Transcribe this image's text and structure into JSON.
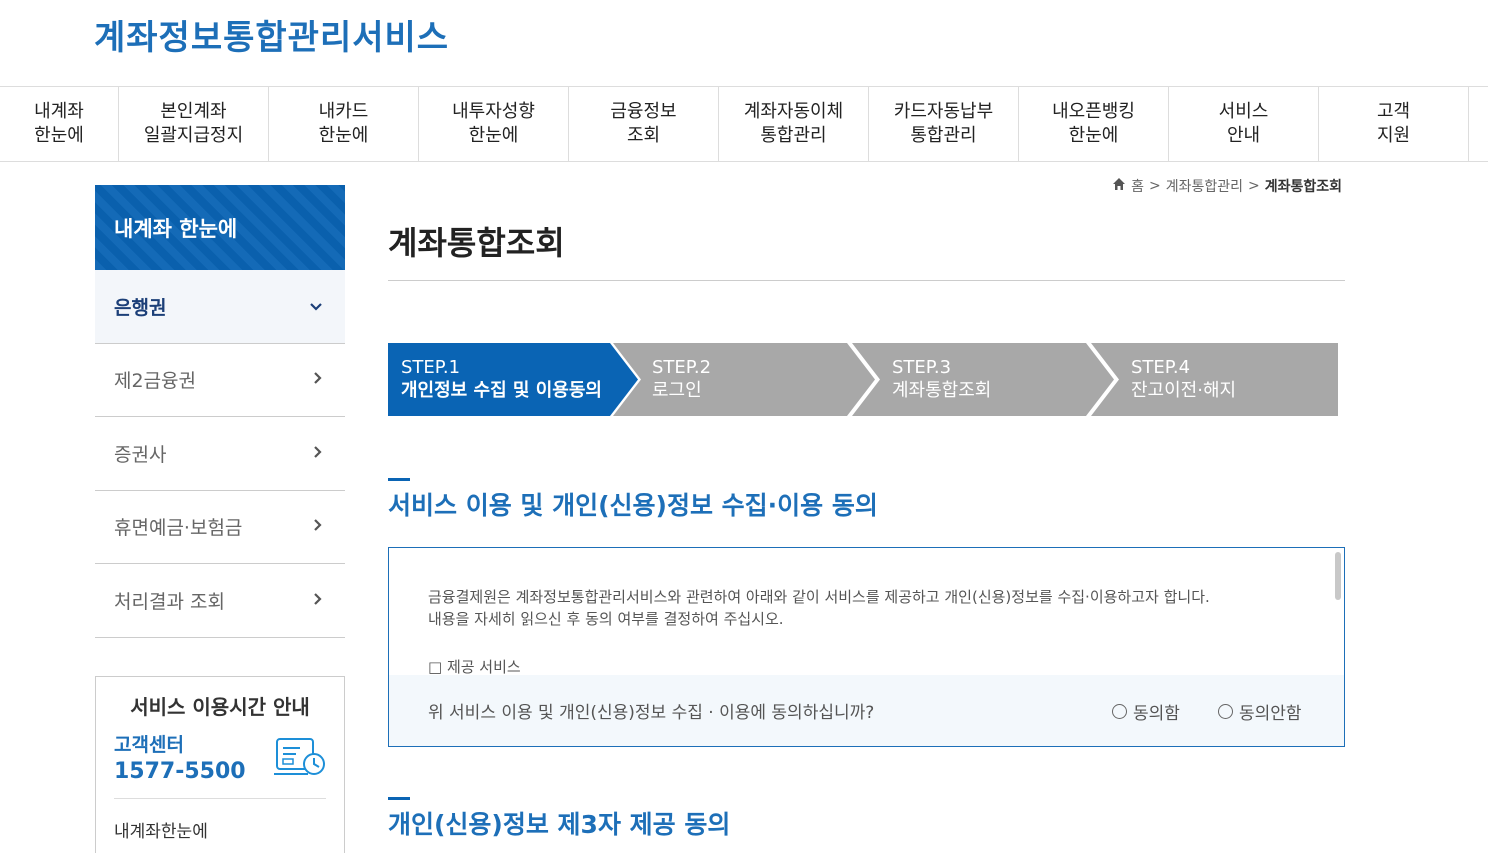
{
  "header": {
    "logo_text": "계좌정보통합관리서비스"
  },
  "gnb": [
    {
      "label": "내계좌\n한눈에"
    },
    {
      "label": "본인계좌\n일괄지급정지"
    },
    {
      "label": "내카드\n한눈에"
    },
    {
      "label": "내투자성향\n한눈에"
    },
    {
      "label": "금융정보\n조회"
    },
    {
      "label": "계좌자동이체\n통합관리"
    },
    {
      "label": "카드자동납부\n통합관리"
    },
    {
      "label": "내오픈뱅킹\n한눈에"
    },
    {
      "label": "서비스\n안내"
    },
    {
      "label": "고객\n지원"
    }
  ],
  "sidebar": {
    "title": "내계좌 한눈에",
    "items": [
      {
        "label": "은행권",
        "icon": "chevron-down-icon",
        "active": true
      },
      {
        "label": "제2금융권",
        "icon": "chevron-right-icon"
      },
      {
        "label": "증권사",
        "icon": "chevron-right-icon"
      },
      {
        "label": "휴면예금·보험금",
        "icon": "chevron-right-icon"
      },
      {
        "label": "처리결과 조회",
        "icon": "chevron-right-icon"
      }
    ],
    "service_box": {
      "title": "서비스 이용시간 안내",
      "cs_label": "고객센터",
      "cs_phone": "1577-5500",
      "link": "내계좌한눈에"
    }
  },
  "breadcrumb": {
    "home": "홈",
    "level1": "계좌통합관리",
    "current": "계좌통합조회",
    "separator": ">"
  },
  "page": {
    "title": "계좌통합조회"
  },
  "steps": [
    {
      "num": "STEP.1",
      "label": "개인정보 수집 및 이용동의",
      "active": true
    },
    {
      "num": "STEP.2",
      "label": "로그인"
    },
    {
      "num": "STEP.3",
      "label": "계좌통합조회"
    },
    {
      "num": "STEP.4",
      "label": "잔고이전·해지"
    }
  ],
  "section1": {
    "title": "서비스 이용 및 개인(신용)정보 수집·이용 동의",
    "body_line1": "금융결제원은 계좌정보통합관리서비스와 관련하여 아래와 같이 서비스를 제공하고 개인(신용)정보를 수집·이용하고자 합니다.",
    "body_line2": "내용을 자세히 읽으신 후 동의 여부를 결정하여 주십시오.",
    "item1": "□ 제공 서비스",
    "question": "위 서비스 이용 및 개인(신용)정보 수집 · 이용에 동의하십니까?",
    "agree": "동의함",
    "disagree": "동의안함"
  },
  "section2": {
    "title": "개인(신용)정보 제3자 제공 동의"
  },
  "colors": {
    "brand_blue": "#0a64b4",
    "text_blue": "#1d6fb8",
    "step_inactive": "#a8a8a8"
  }
}
